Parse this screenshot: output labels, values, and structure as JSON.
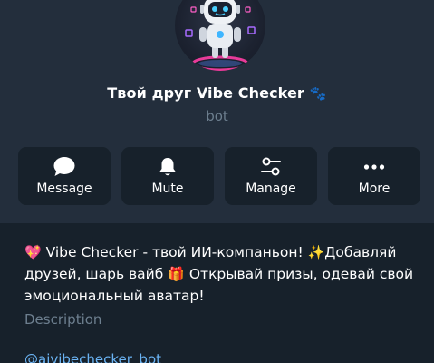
{
  "profile": {
    "name": "Твой друг Vibe Checker",
    "name_emoji": "🐾",
    "type_label": "bot"
  },
  "actions": [
    {
      "label": "Message",
      "icon": "chat-bubble-icon"
    },
    {
      "label": "Mute",
      "icon": "bell-icon"
    },
    {
      "label": "Manage",
      "icon": "sliders-icon"
    },
    {
      "label": "More",
      "icon": "more-dots-icon"
    }
  ],
  "about": {
    "emoji_heart": "💖",
    "text_1": " Vibe Checker - твой ИИ-компаньон! ",
    "emoji_sparkles": "✨",
    "text_2": "Добавляй друзей, шарь вайб ",
    "emoji_gift": "🎁",
    "text_3": " Открывай призы, одевай свой эмоциональный аватар!",
    "caption": "Description"
  },
  "username": {
    "handle": "@aivibechecker_bot"
  },
  "colors": {
    "panel_background": "#232e3c",
    "page_background": "#17212b",
    "button_background": "#17212b",
    "secondary_text": "#6d7f8f",
    "link": "#6ab3f3"
  }
}
